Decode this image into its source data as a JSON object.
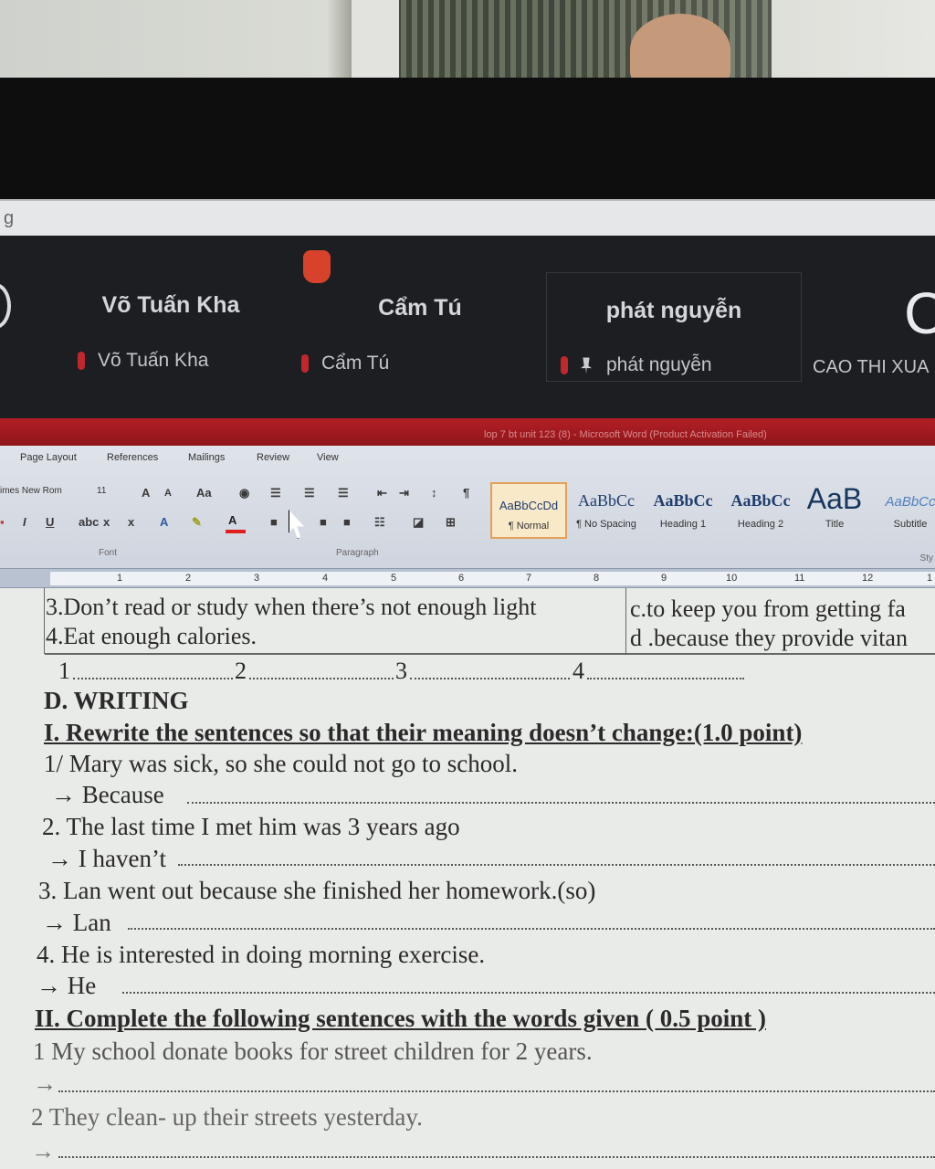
{
  "window_title_fragment": "g",
  "meeting": {
    "participants": [
      {
        "display_name": "Võ Tuấn Kha",
        "label": "Võ Tuấn Kha"
      },
      {
        "display_name": "Cẩm Tú",
        "label": "Cẩm Tú"
      },
      {
        "display_name": "phát nguyễn",
        "label": "phát nguyễn"
      },
      {
        "display_name": "C",
        "label": "CAO THI XUA"
      }
    ]
  },
  "word": {
    "title": "lop 7 bt unit 123 (8) - Microsoft Word (Product Activation Failed)",
    "tabs": [
      "Page Layout",
      "References",
      "Mailings",
      "Review",
      "View"
    ],
    "font_name": "imes New Rom",
    "font_size": "11",
    "groups": {
      "font": "Font",
      "paragraph": "Paragraph",
      "styles": "Sty"
    },
    "styles": [
      {
        "preview": "AaBbCcDd",
        "name": "¶ Normal"
      },
      {
        "preview": "AaBbCc",
        "name": "¶ No Spacing"
      },
      {
        "preview": "AaBbCc",
        "name": "Heading 1"
      },
      {
        "preview": "AaBbCc",
        "name": "Heading 2"
      },
      {
        "preview": "AaB",
        "name": "Title"
      },
      {
        "preview": "AaBbCc",
        "name": "Subtitle"
      }
    ],
    "ruler_marks": [
      "1",
      "2",
      "3",
      "4",
      "5",
      "6",
      "7",
      "8",
      "9",
      "10",
      "11",
      "12",
      "1"
    ]
  },
  "document": {
    "table_left": [
      "3.Don’t read or study when there’s not enough light",
      "4.Eat enough calories."
    ],
    "table_right": [
      "c.to keep you from getting fa",
      "d .because they provide vitan"
    ],
    "answer_nums": [
      "1",
      "2",
      "3",
      "4"
    ],
    "section_d": "D. WRITING",
    "part1_title": "I. Rewrite the sentences so that their meaning doesn’t change:(1.0 point)",
    "items": [
      {
        "q": "1/ Mary was sick, so she could not go to school.",
        "a": "→ Because"
      },
      {
        "q": "2. The last time I met him was 3 years ago",
        "a": "→ I haven’t"
      },
      {
        "q": "3. Lan went out because she finished her homework.(so)",
        "a": "→ Lan"
      },
      {
        "q": "4. He is interested in doing morning exercise.",
        "a": "→ He"
      }
    ],
    "part2_title": "II. Complete the following sentences with the words given ( 0.5 point )",
    "part2_items": [
      {
        "q": "1  My school   donate books for street children   for 2 years.",
        "a": "→"
      },
      {
        "q": "2  They   clean- up  their streets   yesterday.",
        "a": "→"
      }
    ]
  }
}
